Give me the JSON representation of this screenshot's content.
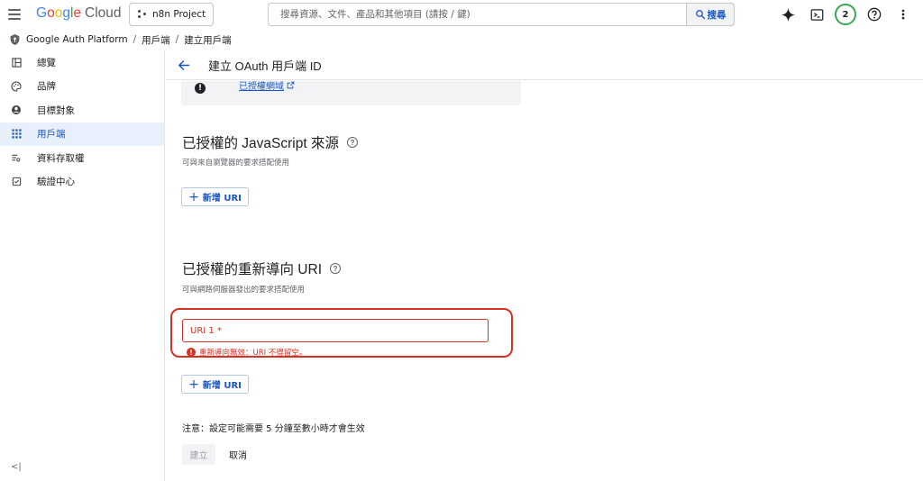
{
  "topbar": {
    "logo_google": [
      "G",
      "o",
      "o",
      "g",
      "l",
      "e"
    ],
    "logo_cloud": "Cloud",
    "project_name": "n8n Project",
    "search_placeholder": "搜尋資源、文件、產品和其他項目 (請按 / 鍵)",
    "search_button": "搜尋",
    "notification_count": "2"
  },
  "breadcrumb": {
    "items": [
      "Google Auth Platform",
      "用戶端",
      "建立用戶端"
    ]
  },
  "sidebar": {
    "items": [
      {
        "label": "總覽",
        "icon": "dashboard-icon"
      },
      {
        "label": "品牌",
        "icon": "palette-icon"
      },
      {
        "label": "目標對象",
        "icon": "account-circle-icon"
      },
      {
        "label": "用戶端",
        "icon": "apps-grid-icon",
        "active": true
      },
      {
        "label": "資料存取權",
        "icon": "data-access-icon"
      },
      {
        "label": "驗證中心",
        "icon": "verification-icon"
      }
    ],
    "collapse_label": "<|"
  },
  "header": {
    "title": "建立 OAuth 用戶端 ID"
  },
  "info_box": {
    "link_text": "已授權網域"
  },
  "js_origins": {
    "title": "已授權的 JavaScript 來源",
    "description": "可與來自瀏覽器的要求搭配使用",
    "add_button": "新增 URI"
  },
  "redirect_uris": {
    "title": "已授權的重新導向 URI",
    "description": "可與網路伺服器發出的要求搭配使用",
    "field_placeholder": "URI 1 *",
    "error_text": "重新導向無效：URI 不得留空。",
    "add_button": "新增 URI"
  },
  "footer": {
    "note": "注意：設定可能需要 5 分鐘至數小時才會生效",
    "create_button": "建立",
    "cancel_button": "取消"
  },
  "colors": {
    "accent": "#1a56c4",
    "error": "#d93025",
    "active_bg": "#e8f0fe"
  }
}
